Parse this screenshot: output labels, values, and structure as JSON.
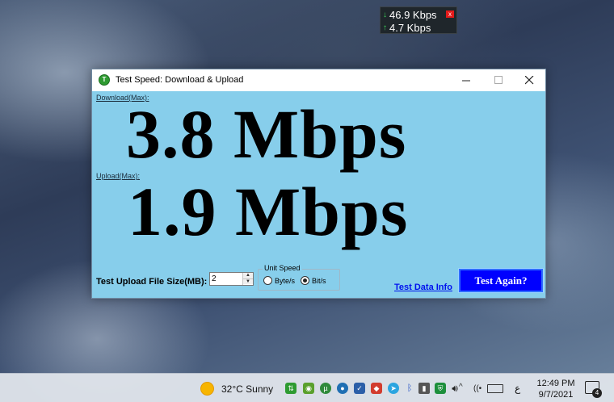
{
  "netmeter": {
    "download": "46.9 Kbps",
    "upload": "4.7 Kbps",
    "close_glyph": "x",
    "download_arrow": "↓",
    "upload_arrow": "↑"
  },
  "window": {
    "title": "Test Speed: Download & Upload",
    "controls": {
      "minimize": "—",
      "maximize": "☐",
      "close": "✕"
    },
    "icon_letter": "T"
  },
  "results": {
    "download_label": "Download(Max):",
    "download_value": "3.8 Mbps",
    "upload_label": "Upload(Max):",
    "upload_value": "1.9 Mbps"
  },
  "controls": {
    "file_size_label": "Test Upload File Size(MB):",
    "file_size_value": "2",
    "unit_speed_legend": "Unit Speed",
    "unit_options": [
      "Byte/s",
      "Bit/s"
    ],
    "selected_unit": "Bit/s",
    "test_data_link": "Test Data Info",
    "test_again_button": "Test Again?"
  },
  "taskbar": {
    "weather": "32°C  Sunny",
    "language": "ع",
    "time": "12:49 PM",
    "date": "9/7/2021",
    "notification_count": "4"
  },
  "colors": {
    "window_bg": "#87ceeb",
    "button_bg": "#0000ff",
    "link": "#0011ee"
  }
}
